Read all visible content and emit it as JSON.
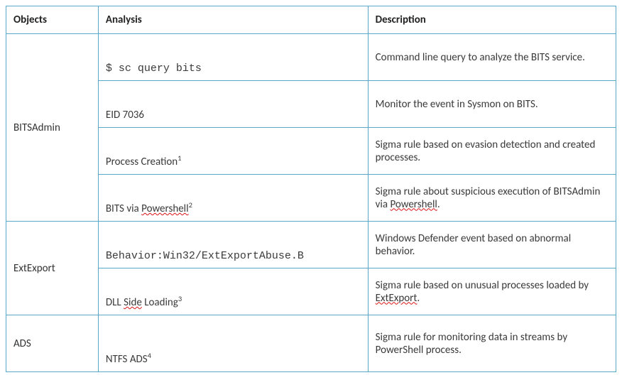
{
  "chart_data": {
    "type": "table",
    "columns": [
      "Objects",
      "Analysis",
      "Description"
    ],
    "rows": [
      {
        "object": "BITSAdmin",
        "analysis": "$ sc query bits",
        "analysis_mono": true,
        "footnote": "",
        "description": "Command line query to analyze the BITS service."
      },
      {
        "object": "BITSAdmin",
        "analysis": "EID 7036",
        "analysis_mono": false,
        "footnote": "",
        "description": "Monitor the event in Sysmon on BITS."
      },
      {
        "object": "BITSAdmin",
        "analysis": "Process Creation",
        "analysis_mono": false,
        "footnote": "1",
        "description": "Sigma rule based on evasion detection and created processes."
      },
      {
        "object": "BITSAdmin",
        "analysis": "BITS via Powershell",
        "analysis_mono": false,
        "footnote": "2",
        "description": "Sigma rule about suspicious execution of BITSAdmin via Powershell."
      },
      {
        "object": "ExtExport",
        "analysis": "Behavior:Win32/ExtExportAbuse.B",
        "analysis_mono": true,
        "footnote": "",
        "description": "Windows Defender event based on abnormal behavior."
      },
      {
        "object": "ExtExport",
        "analysis_pre": "DLL ",
        "analysis_squig": "Side",
        "analysis_post": " Loading",
        "analysis_mono": false,
        "footnote": "3",
        "description": "Sigma rule based on unusual processes loaded by ExtExport."
      },
      {
        "object": "ADS",
        "analysis": "NTFS ADS",
        "analysis_mono": false,
        "footnote": "4",
        "description": "Sigma rule for monitoring data in streams by PowerShell process."
      }
    ]
  },
  "headers": {
    "objects": "Objects",
    "analysis": "Analysis",
    "description": "Description"
  },
  "objects": {
    "bitsadmin": "BITSAdmin",
    "extexport": "ExtExport",
    "ads": "ADS"
  },
  "rows": {
    "r1": {
      "analysis": "$ sc query bits",
      "description": "Command line query to analyze the BITS service."
    },
    "r2": {
      "analysis": "EID 7036",
      "description": "Monitor the event in Sysmon on BITS."
    },
    "r3": {
      "analysis": "Process Creation",
      "footnote": "1",
      "description": "Sigma rule based on evasion detection and created processes."
    },
    "r4": {
      "analysis_pre": "BITS via ",
      "analysis_squig": "Powershell",
      "footnote": "2",
      "description_pre": "Sigma rule about suspicious execution of BITSAdmin via ",
      "description_squig": "Powershell",
      "description_post": "."
    },
    "r5": {
      "analysis": "Behavior:Win32/ExtExportAbuse.B",
      "description": "Windows Defender event based on abnormal behavior."
    },
    "r6": {
      "analysis_pre": "DLL ",
      "analysis_squig": "Side",
      "analysis_post": " Loading",
      "footnote": "3",
      "description_pre": "Sigma rule based on unusual processes loaded by ",
      "description_squig": "ExtExport",
      "description_post": "."
    },
    "r7": {
      "analysis": "NTFS ADS",
      "footnote": "4",
      "description": "Sigma rule for monitoring data in streams by PowerShell process."
    }
  }
}
